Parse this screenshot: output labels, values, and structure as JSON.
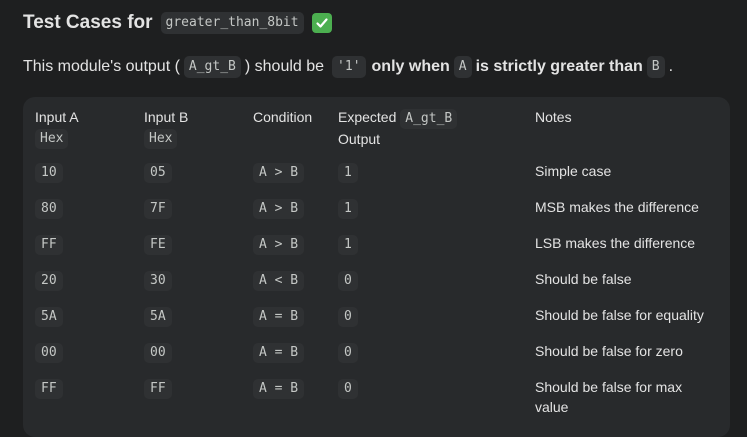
{
  "title": {
    "prefix": "Test Cases for",
    "module": "greater_than_8bit"
  },
  "description": {
    "part1": "This module's output (",
    "signal": "A_gt_B",
    "part2": ") should be",
    "value": "'1'",
    "part3": "only when",
    "a": "A",
    "part4": "is strictly greater than",
    "b": "B",
    "part5": "."
  },
  "table": {
    "headers": {
      "input_a": "Input A",
      "input_a_sub": "Hex",
      "input_b": "Input B",
      "input_b_sub": "Hex",
      "condition": "Condition",
      "expected": "Expected",
      "expected_code": "A_gt_B",
      "expected_sub": "Output",
      "notes": "Notes"
    },
    "rows": [
      {
        "a": "10",
        "b": "05",
        "cond": "A > B",
        "out": "1",
        "note": "Simple case"
      },
      {
        "a": "80",
        "b": "7F",
        "cond": "A > B",
        "out": "1",
        "note": "MSB makes the difference"
      },
      {
        "a": "FF",
        "b": "FE",
        "cond": "A > B",
        "out": "1",
        "note": "LSB makes the difference"
      },
      {
        "a": "20",
        "b": "30",
        "cond": "A < B",
        "out": "0",
        "note": "Should be false"
      },
      {
        "a": "5A",
        "b": "5A",
        "cond": "A = B",
        "out": "0",
        "note": "Should be false for equality"
      },
      {
        "a": "00",
        "b": "00",
        "cond": "A = B",
        "out": "0",
        "note": "Should be false for zero"
      },
      {
        "a": "FF",
        "b": "FF",
        "cond": "A = B",
        "out": "0",
        "note": "Should be false for max value"
      }
    ]
  },
  "colors": {
    "background": "#1e1f20",
    "card": "#282a2c",
    "code_bg": "#2f3133",
    "check": "#4caf50"
  },
  "icons": {
    "title_icon": "check-mark-button-icon"
  }
}
